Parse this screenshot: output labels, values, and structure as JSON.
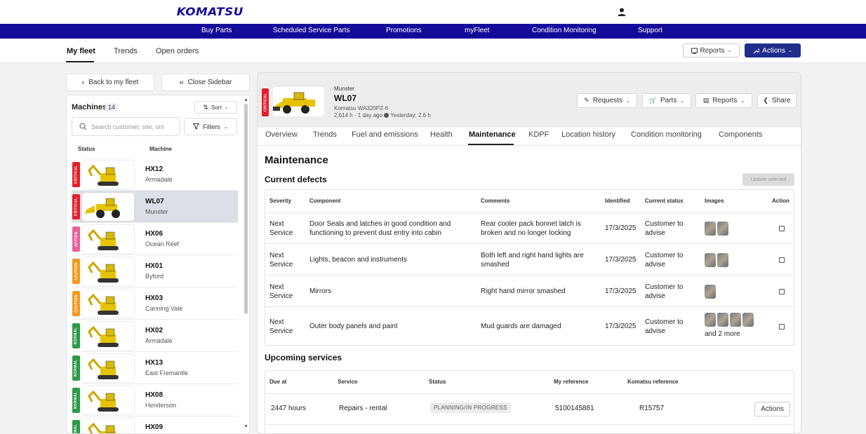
{
  "brand": {
    "logo_text": "KOMATSU",
    "primary_color": "#140a9a"
  },
  "nav": {
    "items": [
      "Buy Parts",
      "Scheduled Service Parts",
      "Promotions",
      "myFleet",
      "Condition Monitoring",
      "Support"
    ]
  },
  "subnav": {
    "tabs": [
      "My fleet",
      "Trends",
      "Open orders"
    ],
    "active": "My fleet",
    "reports_label": "Reports",
    "actions_label": "Actions"
  },
  "sidebar": {
    "back_label": "Back to my fleet",
    "close_label": "Close Sidebar",
    "title": "Machines",
    "count": "14",
    "sort_label": "Sort",
    "search_placeholder": "Search customer, site, uni",
    "filter_label": "Filters",
    "col_status": "Status",
    "col_machine": "Machine",
    "machines": [
      {
        "name": "HX12",
        "site": "Armadale",
        "status": "CRITICAL",
        "color": "#e0202c"
      },
      {
        "name": "WL07",
        "site": "Munster",
        "status": "CRITICAL",
        "color": "#e0202c"
      },
      {
        "name": "HX06",
        "site": "Ocean Reef",
        "status": "ACTION",
        "color": "#e8609a"
      },
      {
        "name": "HX01",
        "site": "Byford",
        "status": "CAUTION",
        "color": "#f29a1f"
      },
      {
        "name": "HX03",
        "site": "Canning Vale",
        "status": "CAUTION",
        "color": "#f29a1f"
      },
      {
        "name": "HX02",
        "site": "Armadale",
        "status": "NORMAL",
        "color": "#2e9b48"
      },
      {
        "name": "HX13",
        "site": "East Fremantle",
        "status": "NORMAL",
        "color": "#2e9b48"
      },
      {
        "name": "HX08",
        "site": "Henderson",
        "status": "NORMAL",
        "color": "#2e9b48"
      },
      {
        "name": "HX09",
        "site": "",
        "status": "NORMAL",
        "color": "#2e9b48"
      }
    ]
  },
  "machine": {
    "status": "CRITICAL",
    "site": "Munster",
    "name": "WL07",
    "model": "Komatsu WA320PZ-6",
    "hours": "2,614 h · 1 day ago",
    "yesterday": "Yesterday: 2.6 h",
    "buttons": {
      "requests": "Requests",
      "parts": "Parts",
      "reports": "Reports",
      "share": "Share"
    }
  },
  "tabs": [
    "Overview",
    "Trends",
    "Fuel and emissions",
    "Health",
    "Maintenance",
    "KDPF",
    "Location history",
    "Condition monitoring",
    "Components"
  ],
  "maintenance": {
    "title": "Maintenance",
    "defects_title": "Current defects",
    "update_label": "Update selected",
    "defect_headers": [
      "Severity",
      "Component",
      "Comments",
      "Identified",
      "Current status",
      "Images",
      "Action"
    ],
    "defects": [
      {
        "severity": "Next Service",
        "component": "Door Seals and latches in good condition and functioning to prevent dust entry into cabin",
        "comments": "Rear cooler pack bonnet latch is broken and no longer locking",
        "identified": "17/3/2025",
        "status": "Customer to advise",
        "image_count": 2,
        "more": ""
      },
      {
        "severity": "Next Service",
        "component": "Lights, beacon and instruments",
        "comments": "Both left and right hand lights are smashed",
        "identified": "17/3/2025",
        "status": "Customer to advise",
        "image_count": 2,
        "more": ""
      },
      {
        "severity": "Next Service",
        "component": "Mirrors",
        "comments": "Right hand mirror smashed",
        "identified": "17/3/2025",
        "status": "Customer to advise",
        "image_count": 1,
        "more": ""
      },
      {
        "severity": "Next Service",
        "component": "Outer body panels and paint",
        "comments": "Mud guards are damaged",
        "identified": "17/3/2025",
        "status": "Customer to advise",
        "image_count": 4,
        "more": "and 2 more"
      }
    ],
    "services_title": "Upcoming services",
    "service_headers": [
      "Due at",
      "Service",
      "Status",
      "My reference",
      "Komatsu reference"
    ],
    "services": [
      {
        "due": "2447 hours",
        "service": "Repairs - rental",
        "status": "PLANNING/IN PROGRESS",
        "my_ref": "5100145881",
        "komatsu_ref": "R15757",
        "action": "Actions"
      }
    ]
  }
}
